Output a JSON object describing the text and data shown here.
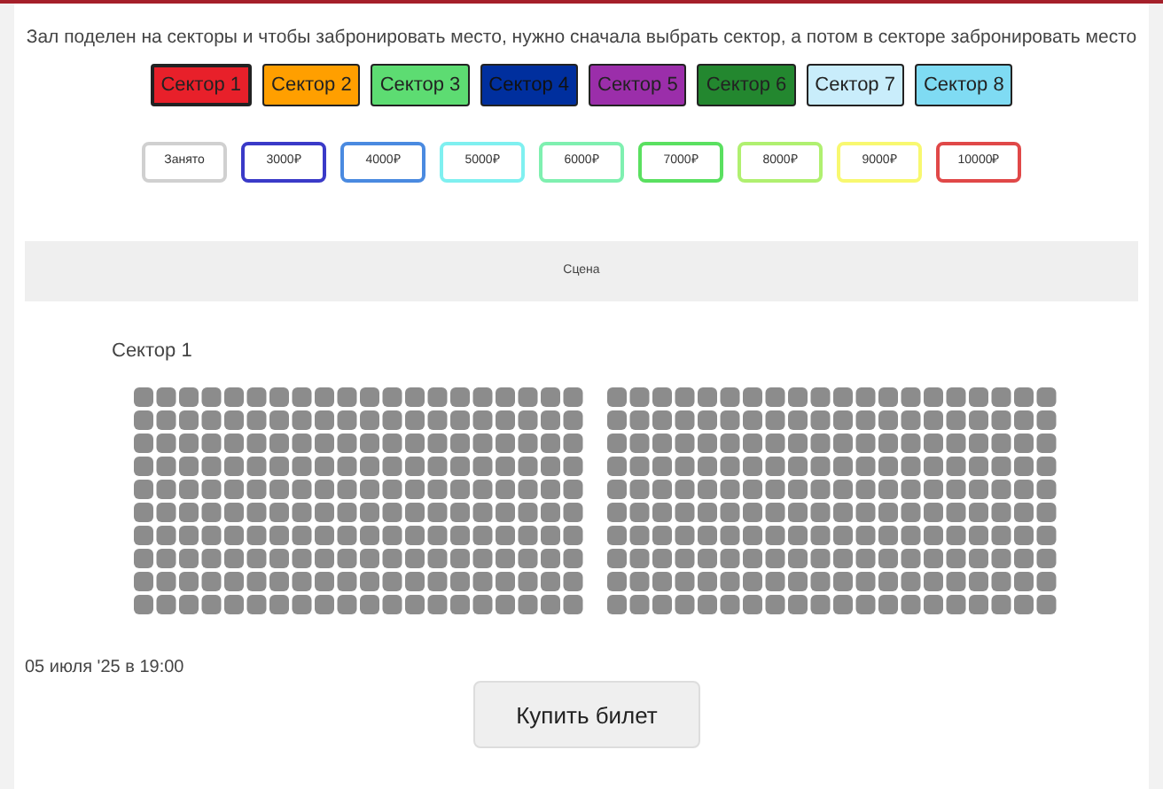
{
  "intro": "Зал поделен на секторы и чтобы забронировать место, нужно сначала выбрать сектор, а потом в секторе забронировать место",
  "sectors": [
    {
      "label": "Сектор 1",
      "color": "#e8202a",
      "selected": true
    },
    {
      "label": "Сектор 2",
      "color": "#ff9f00",
      "selected": false
    },
    {
      "label": "Сектор 3",
      "color": "#5ddc72",
      "selected": false
    },
    {
      "label": "Сектор 4",
      "color": "#002f9e",
      "selected": false
    },
    {
      "label": "Сектор 5",
      "color": "#9b2eaa",
      "selected": false
    },
    {
      "label": "Сектор 6",
      "color": "#23872f",
      "selected": false
    },
    {
      "label": "Сектор 7",
      "color": "#c9edfb",
      "selected": false
    },
    {
      "label": "Сектор 8",
      "color": "#7fdbf3",
      "selected": false
    }
  ],
  "legend": [
    {
      "label": "Занято",
      "color": "#d0d0d0"
    },
    {
      "label": "3000₽",
      "color": "#3a3ac8"
    },
    {
      "label": "4000₽",
      "color": "#4a8ae0"
    },
    {
      "label": "5000₽",
      "color": "#7ff0f0"
    },
    {
      "label": "6000₽",
      "color": "#7ff0b0"
    },
    {
      "label": "7000₽",
      "color": "#5ae060"
    },
    {
      "label": "8000₽",
      "color": "#b0f070"
    },
    {
      "label": "9000₽",
      "color": "#f8f870"
    },
    {
      "label": "10000₽",
      "color": "#e04848"
    }
  ],
  "stage": "Сцена",
  "sector_title": "Сектор 1",
  "seat_blocks": [
    {
      "taken": true
    },
    {
      "taken": true
    }
  ],
  "date": "05 июля '25 в 19:00",
  "buy_button": "Купить билет"
}
